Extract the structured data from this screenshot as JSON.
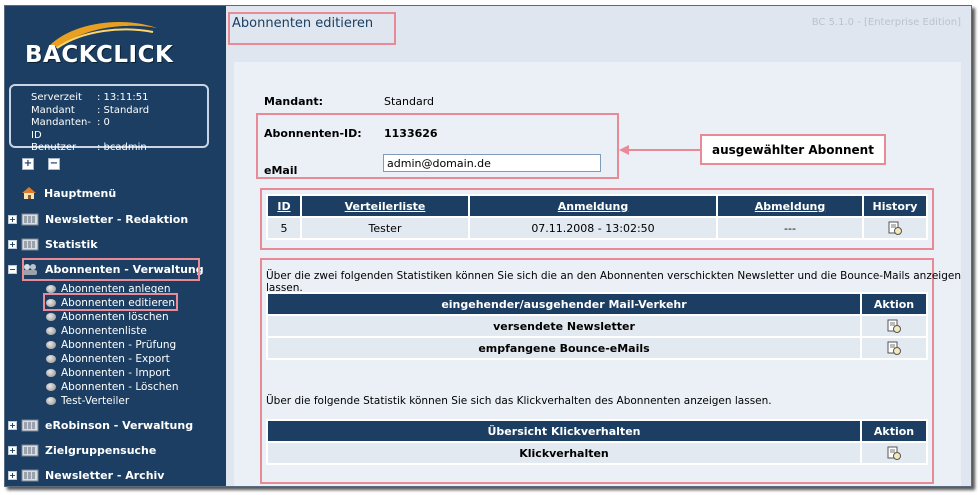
{
  "app": {
    "name": "BACKCLICK",
    "version": "BC 5.1.0 - [Enterprise Edition]"
  },
  "server_info": {
    "rows": [
      {
        "key": "Serverzeit",
        "value": ": 13:11:51"
      },
      {
        "key": "Mandant",
        "value": ": Standard"
      },
      {
        "key": "Mandanten-ID",
        "value": ": 0"
      },
      {
        "key": "Benutzer",
        "value": ": bcadmin"
      }
    ]
  },
  "tree_controls": {
    "expand": "+",
    "collapse": "−"
  },
  "nav": {
    "hauptmenu": "Hauptmenü",
    "newsletter_redaktion": "Newsletter - Redaktion",
    "statistik": "Statistik",
    "abonnenten_verwaltung": "Abonnenten - Verwaltung",
    "sub_items": [
      "Abonnenten anlegen",
      "Abonnenten editieren",
      "Abonnenten löschen",
      "Abonnentenliste",
      "Abonnenten - Prüfung",
      "Abonnenten - Export",
      "Abonnenten - Import",
      "Abonnenten - Löschen",
      "Test-Verteiler"
    ],
    "erobinson": "eRobinson - Verwaltung",
    "zielgruppensuche": "Zielgruppensuche",
    "newsletter_archiv": "Newsletter - Archiv"
  },
  "page": {
    "title": "Abonnenten editieren",
    "mandant_label": "Mandant:",
    "mandant_value": "Standard",
    "abo_id_label": "Abonnenten-ID:",
    "abo_id_value": "1133626",
    "email_label": "eMail",
    "email_value": "admin@domain.de",
    "callout": "ausgewählter Abonnent"
  },
  "subscription_table": {
    "headers": [
      "ID",
      "Verteilerliste",
      "Anmeldung",
      "Abmeldung",
      "History"
    ],
    "row": [
      "5",
      "Tester",
      "07.11.2008 - 13:02:50",
      "---"
    ]
  },
  "stats": {
    "intro": "Über die zwei folgenden Statistiken können Sie sich die an den Abonnenten verschickten Newsletter und die Bounce-Mails anzeigen lassen.",
    "mail_table": {
      "headers": [
        "eingehender/ausgehender Mail-Verkehr",
        "Aktion"
      ],
      "rows": [
        "versendete Newsletter",
        "empfangene Bounce-eMails"
      ]
    },
    "click_intro": "Über die folgende Statistik können Sie sich das Klickverhalten des Abonnenten anzeigen lassen.",
    "click_table": {
      "headers": [
        "Übersicht Klickverhalten",
        "Aktion"
      ],
      "rows": [
        "Klickverhalten"
      ]
    }
  },
  "colors": {
    "sidebar": "#1b3e62",
    "highlight": "#e98a97",
    "panel": "#eaf0f6",
    "main": "#dfe6ef"
  }
}
